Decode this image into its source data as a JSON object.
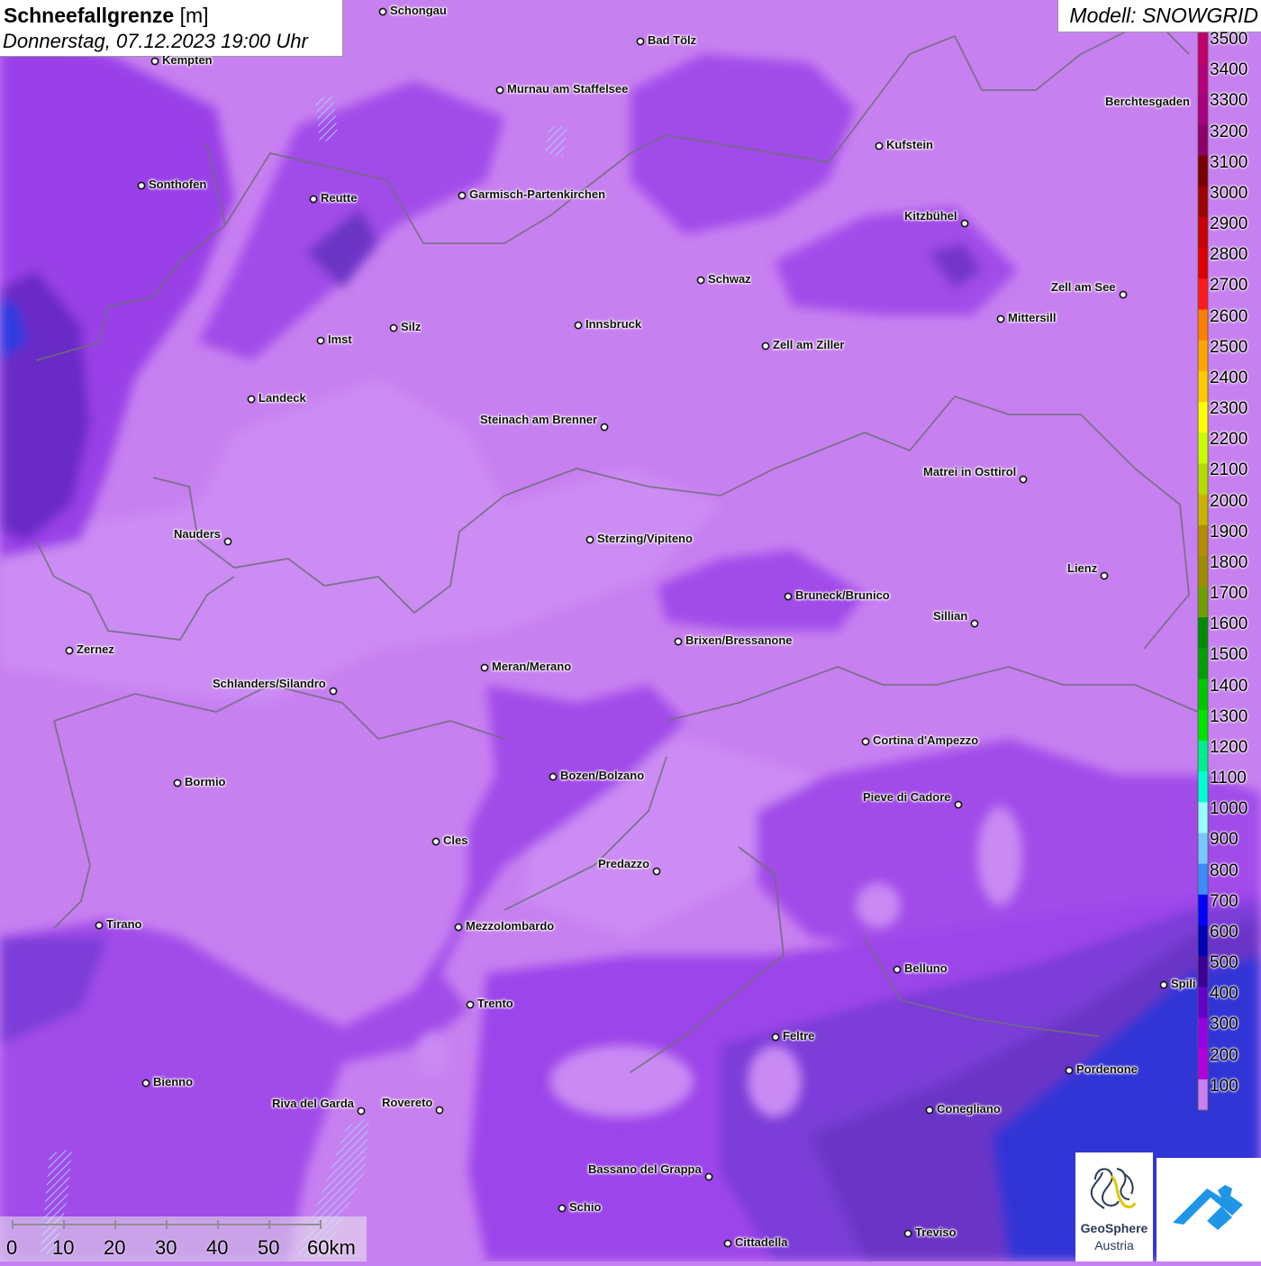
{
  "header": {
    "title": "Schneefallgrenze",
    "unit": "[m]",
    "datetime": "Donnerstag, 07.12.2023 19:00 Uhr",
    "model": "Modell: SNOWGRID"
  },
  "legend": {
    "values": [
      "3500",
      "3400",
      "3300",
      "3200",
      "3100",
      "3000",
      "2900",
      "2800",
      "2700",
      "2600",
      "2500",
      "2400",
      "2300",
      "2200",
      "2100",
      "2000",
      "1900",
      "1800",
      "1700",
      "1600",
      "1500",
      "1400",
      "1300",
      "1200",
      "1100",
      "1000",
      "900",
      "800",
      "700",
      "600",
      "500",
      "400",
      "300",
      "200",
      "100"
    ],
    "colors": [
      "#c4006b",
      "#b8007a",
      "#a8007e",
      "#8f0069",
      "#7a0000",
      "#a00000",
      "#c80000",
      "#e00000",
      "#ff1a1a",
      "#ff7f00",
      "#ffa500",
      "#ffc800",
      "#ffff00",
      "#c8ff00",
      "#b4dc00",
      "#c8b400",
      "#b48c00",
      "#a08c00",
      "#6ea000",
      "#008c00",
      "#00a000",
      "#00c800",
      "#00e600",
      "#00f08c",
      "#00ffd2",
      "#96ffff",
      "#78c8ff",
      "#3c8cff",
      "#0000ff",
      "#0000b4",
      "#3c0096",
      "#6400c8",
      "#9600e6",
      "#b400dc",
      "#c87ff2"
    ]
  },
  "cities": [
    {
      "name": "Schongau"
    },
    {
      "name": "Bad Tölz"
    },
    {
      "name": "Kempten"
    },
    {
      "name": "Murnau am Staffelsee"
    },
    {
      "name": "Kufstein"
    },
    {
      "name": "Sonthofen"
    },
    {
      "name": "Reutte"
    },
    {
      "name": "Garmisch-Partenkirchen"
    },
    {
      "name": "Kitzbühel"
    },
    {
      "name": "Schwaz"
    },
    {
      "name": "Zell am See"
    },
    {
      "name": "Innsbruck"
    },
    {
      "name": "Mittersill"
    },
    {
      "name": "Silz"
    },
    {
      "name": "Imst"
    },
    {
      "name": "Zell am Ziller"
    },
    {
      "name": "Landeck"
    },
    {
      "name": "Steinach am Brenner"
    },
    {
      "name": "Matrei in Osttirol"
    },
    {
      "name": "Nauders"
    },
    {
      "name": "Sterzing/Vipiteno"
    },
    {
      "name": "Lienz"
    },
    {
      "name": "Bruneck/Brunico"
    },
    {
      "name": "Sillian"
    },
    {
      "name": "Zernez"
    },
    {
      "name": "Brixen/Bressanone"
    },
    {
      "name": "Meran/Merano"
    },
    {
      "name": "Schlanders/Silandro"
    },
    {
      "name": "Cortina d'Ampezzo"
    },
    {
      "name": "Bozen/Bolzano"
    },
    {
      "name": "Bormio"
    },
    {
      "name": "Pieve di Cadore"
    },
    {
      "name": "Cles"
    },
    {
      "name": "Predazzo"
    },
    {
      "name": "Tirano"
    },
    {
      "name": "Mezzolombardo"
    },
    {
      "name": "Belluno"
    },
    {
      "name": "Trento"
    },
    {
      "name": "Feltre"
    },
    {
      "name": "Pordenone"
    },
    {
      "name": "Bienno"
    },
    {
      "name": "Riva del Garda"
    },
    {
      "name": "Rovereto"
    },
    {
      "name": "Conegliano"
    },
    {
      "name": "Bassano del Grappa"
    },
    {
      "name": "Schio"
    },
    {
      "name": "Treviso"
    },
    {
      "name": "Cittadella"
    },
    {
      "name": "Berchtesgaden"
    },
    {
      "name": "Spili"
    }
  ],
  "scale": {
    "ticks": [
      "0",
      "10",
      "20",
      "30",
      "40",
      "50",
      "60km"
    ]
  },
  "logo": {
    "name_line1": "GeoSphere",
    "name_line2": "Austria"
  }
}
